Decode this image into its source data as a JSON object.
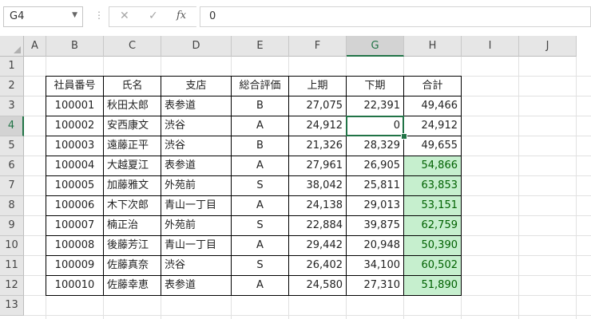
{
  "formula_bar": {
    "name_box": "G4",
    "name_dropdown_icon": "chevron-down-icon",
    "cancel_icon": "✕",
    "enter_icon": "✓",
    "fx_label": "fx",
    "formula": "0"
  },
  "columns": [
    "A",
    "B",
    "C",
    "D",
    "E",
    "F",
    "G",
    "H",
    "I",
    "J"
  ],
  "rows": [
    "1",
    "2",
    "3",
    "4",
    "5",
    "6",
    "7",
    "8",
    "9",
    "10",
    "11",
    "12",
    "13"
  ],
  "selected": {
    "cell": "G4",
    "col": "G",
    "row": "4"
  },
  "colors": {
    "highlight_fill": "#c6efce",
    "highlight_text": "#006100",
    "accent": "#217346"
  },
  "table": {
    "headers": [
      "社員番号",
      "氏名",
      "支店",
      "総合評価",
      "上期",
      "下期",
      "合計"
    ],
    "rows": [
      {
        "id": "100001",
        "name": "秋田太郎",
        "branch": "表参道",
        "rating": "B",
        "h1": "27,075",
        "h2": "22,391",
        "total": "49,466",
        "highlight": false
      },
      {
        "id": "100002",
        "name": "安西康文",
        "branch": "渋谷",
        "rating": "A",
        "h1": "24,912",
        "h2": "0",
        "total": "24,912",
        "highlight": false
      },
      {
        "id": "100003",
        "name": "遠藤正平",
        "branch": "渋谷",
        "rating": "B",
        "h1": "21,326",
        "h2": "28,329",
        "total": "49,655",
        "highlight": false
      },
      {
        "id": "100004",
        "name": "大越夏江",
        "branch": "表参道",
        "rating": "A",
        "h1": "27,961",
        "h2": "26,905",
        "total": "54,866",
        "highlight": true
      },
      {
        "id": "100005",
        "name": "加藤雅文",
        "branch": "外苑前",
        "rating": "S",
        "h1": "38,042",
        "h2": "25,811",
        "total": "63,853",
        "highlight": true
      },
      {
        "id": "100006",
        "name": "木下次郎",
        "branch": "青山一丁目",
        "rating": "A",
        "h1": "24,138",
        "h2": "29,013",
        "total": "53,151",
        "highlight": true
      },
      {
        "id": "100007",
        "name": "楠正治",
        "branch": "外苑前",
        "rating": "S",
        "h1": "22,884",
        "h2": "39,875",
        "total": "62,759",
        "highlight": true
      },
      {
        "id": "100008",
        "name": "後藤芳江",
        "branch": "青山一丁目",
        "rating": "A",
        "h1": "29,442",
        "h2": "20,948",
        "total": "50,390",
        "highlight": true
      },
      {
        "id": "100009",
        "name": "佐藤真奈",
        "branch": "渋谷",
        "rating": "S",
        "h1": "26,402",
        "h2": "34,100",
        "total": "60,502",
        "highlight": true
      },
      {
        "id": "100010",
        "name": "佐藤幸恵",
        "branch": "表参道",
        "rating": "A",
        "h1": "24,580",
        "h2": "27,310",
        "total": "51,890",
        "highlight": true
      }
    ]
  }
}
